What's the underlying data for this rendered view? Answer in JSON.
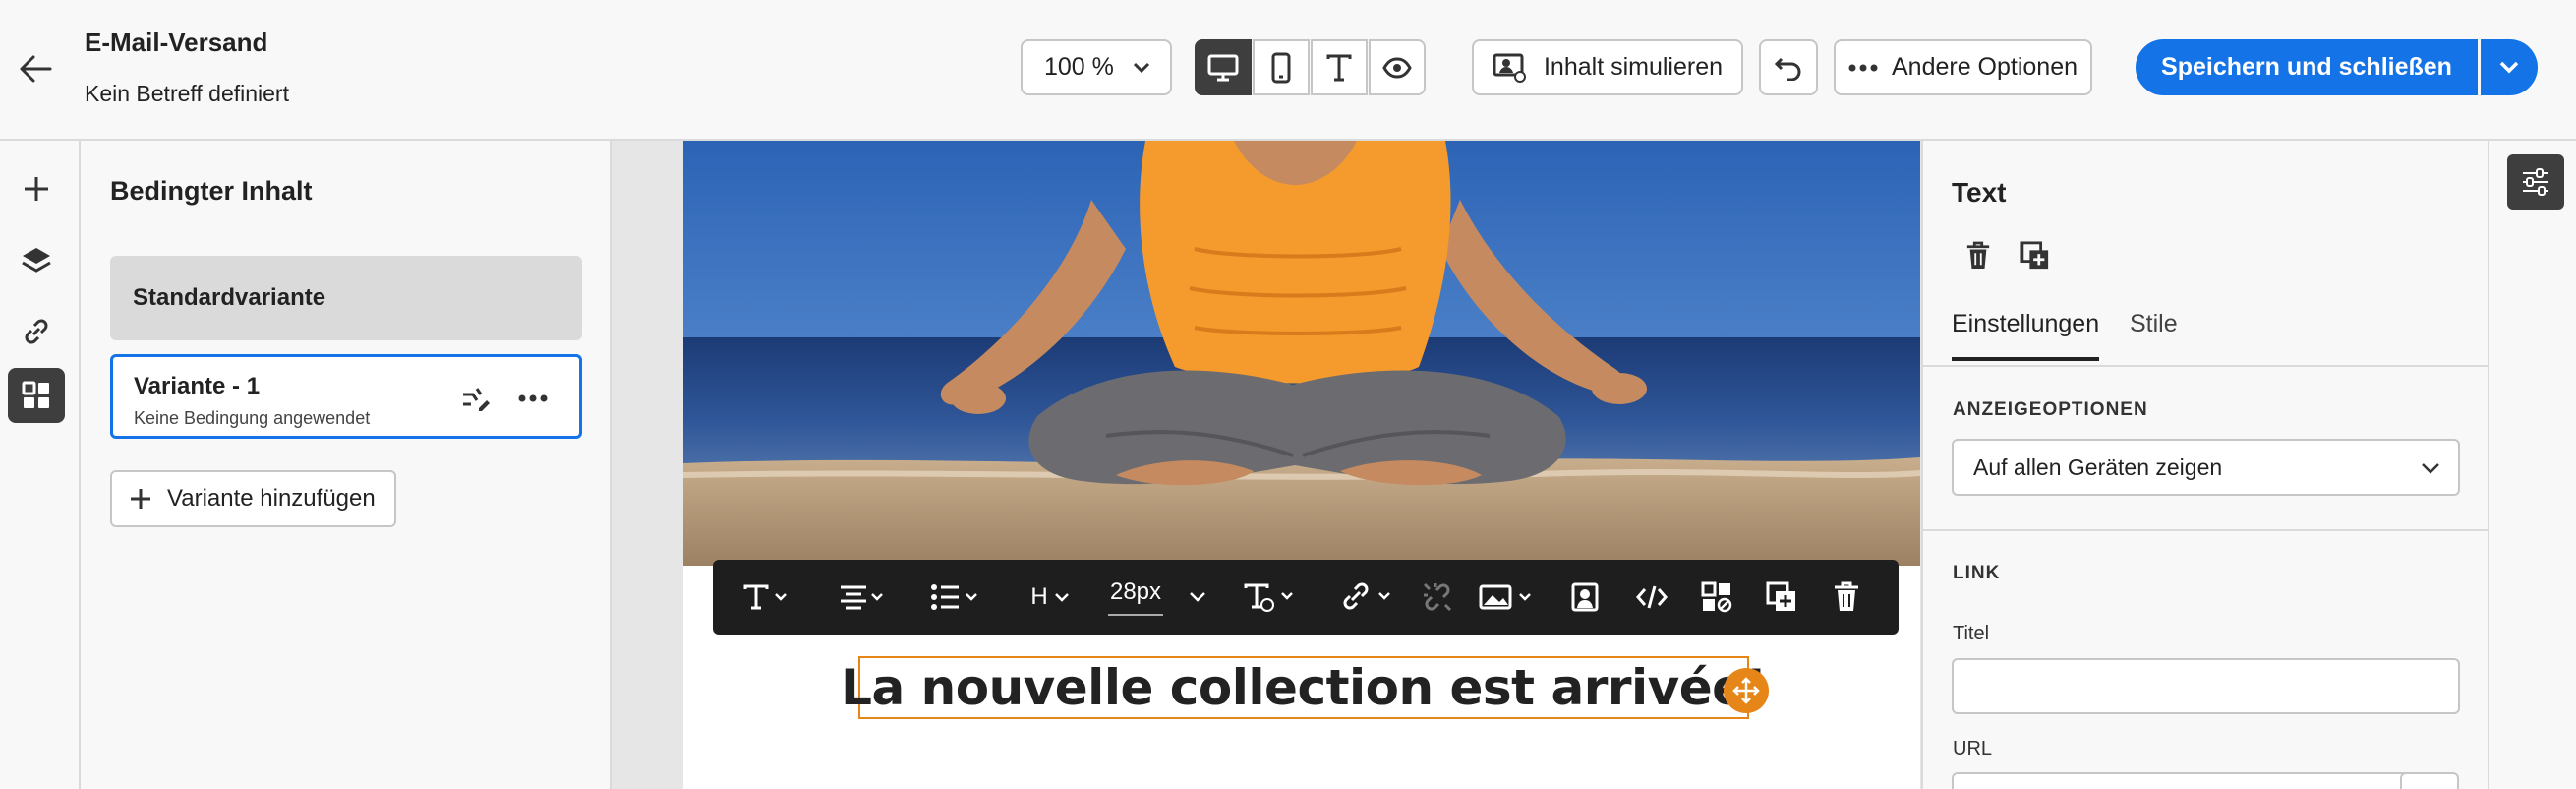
{
  "header": {
    "title": "E-Mail-Versand",
    "subtitle": "Kein Betreff definiert",
    "zoom": "100 %",
    "simulate_label": "Inhalt simulieren",
    "more_options_label": "Andere Optionen",
    "save_close_label": "Speichern und schließen"
  },
  "variants": {
    "title": "Bedingter Inhalt",
    "default_variant": "Standardvariante",
    "items": [
      {
        "name": "Variante - 1",
        "condition": "Keine Bedingung angewendet"
      }
    ],
    "add_label": "Variante hinzufügen"
  },
  "toolbar": {
    "heading": "H",
    "font_size": "28px"
  },
  "email": {
    "headline": "La nouvelle collection est arrivée!"
  },
  "properties": {
    "title": "Text",
    "tabs": [
      "Einstellungen",
      "Stile"
    ],
    "display_section": "ANZEIGEOPTIONEN",
    "display_value": "Auf allen Geräten zeigen",
    "link_section": "LINK",
    "title_label": "Titel",
    "url_label": "URL"
  },
  "colors": {
    "accent": "#1473e6",
    "selection": "#e68619",
    "dark": "#3e3e3e"
  }
}
